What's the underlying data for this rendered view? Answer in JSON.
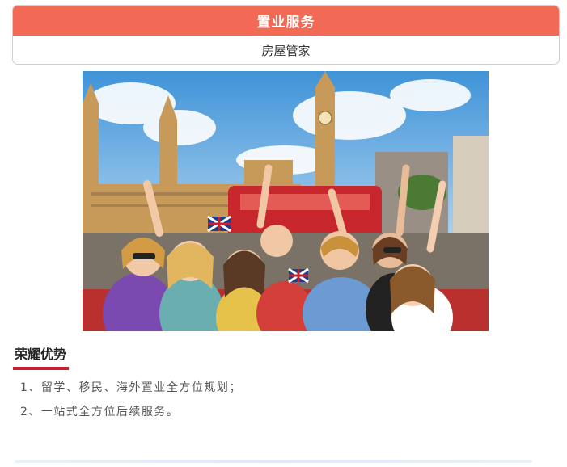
{
  "service_card": {
    "title": "置业服务",
    "subtitle": "房屋管家"
  },
  "photo": {
    "icon": "london-tour-bus-photo"
  },
  "advantages": {
    "title": "荣耀优势",
    "accent_color": "#c8202d",
    "items": [
      "1、留学、移民、海外置业全方位规划；",
      "2、一站式全方位后续服务。"
    ]
  },
  "colors": {
    "header_bg": "#f26a55"
  }
}
